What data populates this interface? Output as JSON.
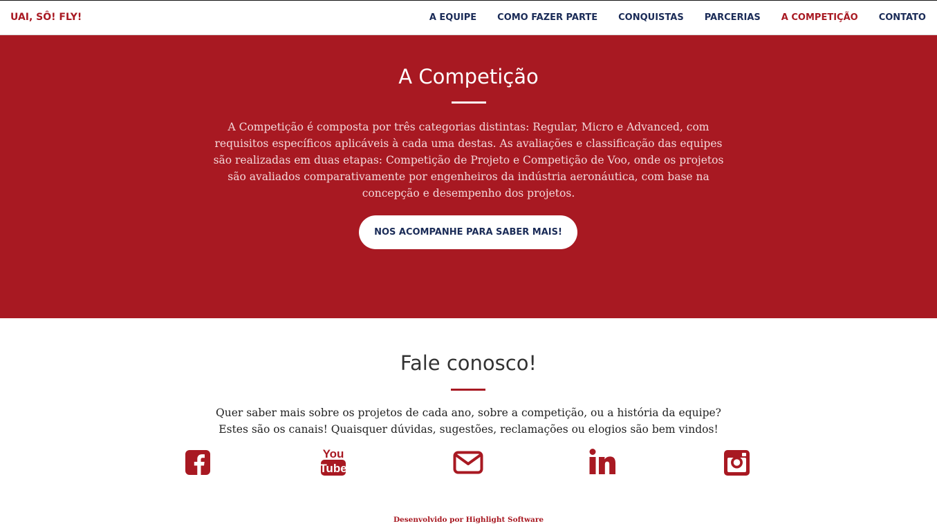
{
  "header": {
    "brand": "UAI, SÔ! FLY!",
    "nav": [
      {
        "label": "A EQUIPE"
      },
      {
        "label": "COMO FAZER PARTE"
      },
      {
        "label": "CONQUISTAS"
      },
      {
        "label": "PARCERIAS"
      },
      {
        "label": "A COMPETIÇÃO",
        "active": true
      },
      {
        "label": "CONTATO"
      }
    ]
  },
  "hero": {
    "title": "A Competição",
    "body": "A Competição é composta por três categorias distintas: Regular, Micro e Advanced, com requisitos específicos aplicáveis à cada uma destas. As avaliações e classificação das equipes são realizadas em duas etapas: Competição de Projeto e Competição de Voo, onde os projetos são avaliados comparativamente por engenheiros da indústria aeronáutica, com base na concepção e desempenho dos projetos.",
    "button": "NOS ACOMPANHE PARA SABER MAIS!"
  },
  "contact": {
    "title": "Fale conosco!",
    "line1": "Quer saber mais sobre os projetos de cada ano, sobre a competição, ou a história da equipe?",
    "line2": "Estes são os canais! Quaisquer dúvidas, sugestões, reclamações ou elogios são bem vindos!",
    "social": [
      {
        "icon": "facebook-icon"
      },
      {
        "icon": "youtube-icon"
      },
      {
        "icon": "email-icon"
      },
      {
        "icon": "linkedin-icon"
      },
      {
        "icon": "instagram-icon"
      }
    ]
  },
  "footer": {
    "credit": "Desenvolvido por Highlight Software"
  },
  "colors": {
    "accent": "#a81922",
    "navy": "#1a2b57",
    "white": "#ffffff"
  }
}
